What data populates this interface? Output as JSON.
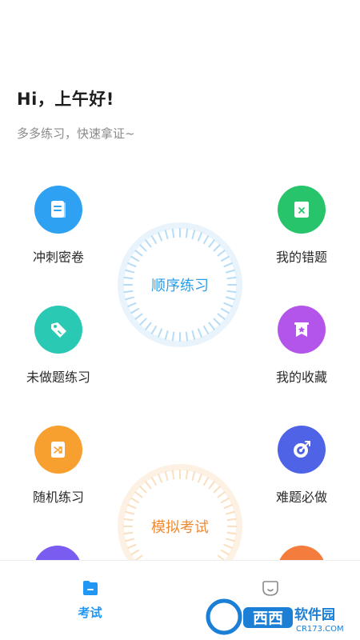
{
  "header": {
    "greeting": "Hi，上午好!",
    "subtitle": "多多练习，快速拿证~"
  },
  "features": {
    "sprint": {
      "label": "冲刺密卷",
      "icon": "document-icon",
      "color": "#2ea1f3"
    },
    "wrong": {
      "label": "我的错题",
      "icon": "wrong-book-icon",
      "color": "#27c46c"
    },
    "undone": {
      "label": "未做题练习",
      "icon": "tag-icon",
      "color": "#29c9b4"
    },
    "favorites": {
      "label": "我的收藏",
      "icon": "bookmark-star-icon",
      "color": "#b355ea"
    },
    "random": {
      "label": "随机练习",
      "icon": "shuffle-icon",
      "color": "#f8a02f"
    },
    "hard": {
      "label": "难题必做",
      "icon": "target-icon",
      "color": "#4f63e6"
    }
  },
  "rings": {
    "sequential": {
      "label": "顺序练习",
      "color": "#2a9ee6"
    },
    "mock": {
      "label": "模拟考试",
      "color": "#ef8a33"
    }
  },
  "tabbar": {
    "exam": {
      "label": "考试",
      "icon": "folder-icon",
      "color": "#2196f3"
    },
    "mine": {
      "icon": "face-icon"
    }
  },
  "watermark": {
    "text": "西西软件园",
    "site": "CR173.COM"
  }
}
